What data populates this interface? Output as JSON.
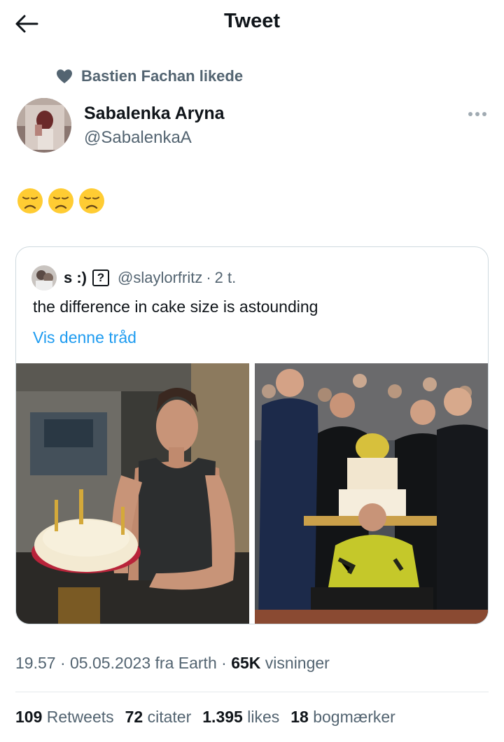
{
  "header": {
    "title": "Tweet"
  },
  "social_context": {
    "text": "Bastien Fachan likede"
  },
  "author": {
    "name": "Sabalenka Aryna",
    "handle": "@SabalenkaA"
  },
  "tweet": {
    "emojis": [
      "😞",
      "😞",
      "😞"
    ]
  },
  "quote": {
    "name": "s :)",
    "badge": "?",
    "handle": "@slaylorfritz",
    "separator": "·",
    "time": "2 t.",
    "text": "the difference in cake size is astounding",
    "show_thread": "Vis denne tråd"
  },
  "meta": {
    "time": "19.57",
    "sep1": " · ",
    "date": "05.05.2023",
    "source": " fra Earth",
    "sep2": " · ",
    "views_count": "65K",
    "views_label": " visninger"
  },
  "stats": {
    "retweets_count": "109",
    "retweets_label": " Retweets",
    "quotes_count": "72",
    "quotes_label": " citater",
    "likes_count": "1.395",
    "likes_label": " likes",
    "bookmarks_count": "18",
    "bookmarks_label": " bogmærker"
  }
}
